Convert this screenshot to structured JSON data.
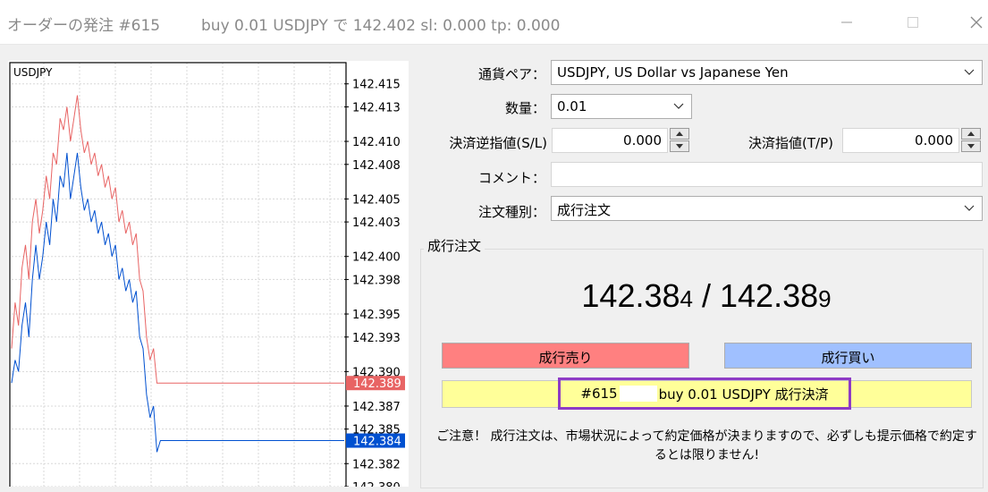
{
  "window": {
    "title": "オーダーの発注 #615",
    "subtitle": "buy 0.01 USDJPY で 142.402 sl: 0.000 tp: 0.000"
  },
  "chart": {
    "symbol": "USDJPY",
    "ask_color": "#e86464",
    "bid_color": "#0050d0",
    "ask_label": "142.389",
    "bid_label": "142.384"
  },
  "chart_data": {
    "type": "line",
    "title": "USDJPY",
    "ylim": [
      142.38,
      142.417
    ],
    "y_ticks": [
      "142.415",
      "142.413",
      "142.410",
      "142.408",
      "142.405",
      "142.403",
      "142.400",
      "142.398",
      "142.395",
      "142.393",
      "142.390",
      "142.387",
      "142.385",
      "142.382",
      "142.380"
    ],
    "grid": true,
    "series": [
      {
        "values": [
          142.392,
          142.396,
          142.394,
          142.399,
          142.401,
          142.398,
          142.403,
          142.405,
          142.402,
          142.404,
          142.407,
          142.405,
          142.409,
          142.408,
          142.412,
          142.411,
          142.413,
          142.41,
          142.412,
          142.414,
          142.411,
          142.409,
          142.41,
          142.408,
          142.409,
          142.407,
          142.408,
          142.406,
          142.407,
          142.405,
          142.406,
          142.403,
          142.404,
          142.402,
          142.403,
          142.401,
          142.402,
          142.398,
          142.397,
          142.393,
          142.391,
          142.392,
          142.389,
          142.389,
          142.389,
          142.389,
          142.389
        ]
      },
      {
        "values": [
          142.389,
          142.391,
          142.39,
          142.394,
          142.396,
          142.393,
          142.398,
          142.401,
          142.398,
          142.4,
          142.403,
          142.401,
          142.405,
          142.403,
          142.407,
          142.406,
          142.409,
          142.405,
          142.407,
          142.409,
          142.406,
          142.404,
          142.405,
          142.403,
          142.404,
          142.402,
          142.403,
          142.401,
          142.402,
          142.4,
          142.401,
          142.398,
          142.399,
          142.397,
          142.398,
          142.396,
          142.397,
          142.393,
          142.392,
          142.388,
          142.386,
          142.387,
          142.383,
          142.384,
          142.384,
          142.384,
          142.384
        ]
      }
    ]
  },
  "form": {
    "symbol_label": "通貨ペア：",
    "symbol_value": "USDJPY, US Dollar vs Japanese Yen",
    "volume_label": "数量：",
    "volume_value": "0.01",
    "sl_label": "決済逆指値(S/L)",
    "sl_value": "0.000",
    "tp_label": "決済指値(T/P)",
    "tp_value": "0.000",
    "comment_label": "コメント：",
    "comment_value": "",
    "type_label": "注文種別：",
    "type_value": "成行注文"
  },
  "market": {
    "group_label": "成行注文",
    "bid_main": "142.38",
    "bid_small": "4",
    "separator": " / ",
    "ask_main": "142.38",
    "ask_small": "9",
    "sell_label": "成行売り",
    "sell_color": "#ff8080",
    "buy_label": "成行買い",
    "buy_color": "#a0c0ff",
    "close_ticket": "#615",
    "close_label": "buy 0.01 USDJPY 成行決済",
    "note": "ご注意！ 成行注文は、市場状況によって約定価格が決まりますので、必ずしも提示価格で約定するとは限りません!"
  }
}
